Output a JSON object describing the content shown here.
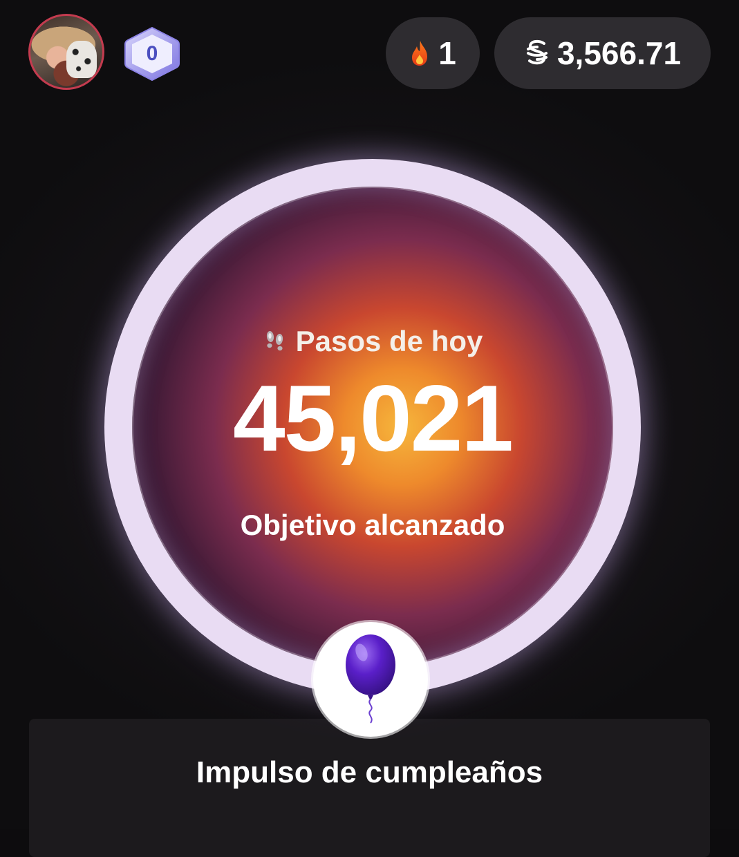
{
  "header": {
    "avatar_alt": "Foto de perfil",
    "level_value": "0",
    "streak": {
      "icon": "flame-icon",
      "value": "1"
    },
    "balance": {
      "icon": "coin-icon",
      "value": "3,566.71"
    }
  },
  "ring": {
    "progress": 1.0,
    "title_icon": "footprint-icon",
    "title": "Pasos de hoy",
    "steps": "45,021",
    "status": "Objetivo alcanzado",
    "colors": {
      "ring": "#e9dcf3",
      "glow_center": "#f6b63c",
      "glow_mid": "#c9472f",
      "glow_edge": "#3e1a36"
    }
  },
  "boost": {
    "icon": "balloon-icon",
    "label": "Impulso de cumpleaños"
  }
}
